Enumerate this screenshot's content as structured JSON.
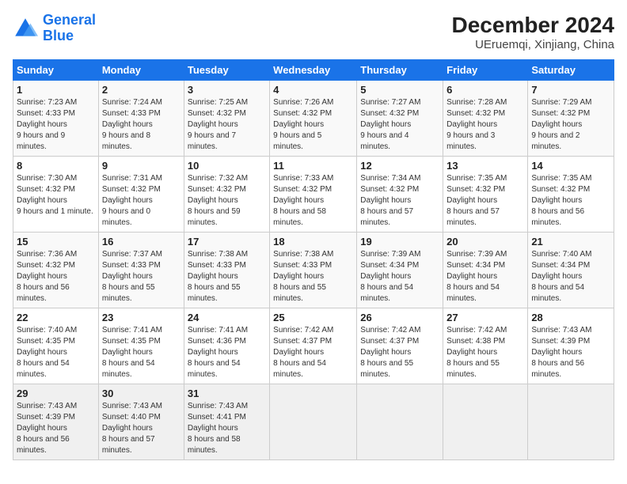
{
  "header": {
    "logo_line1": "General",
    "logo_line2": "Blue",
    "title": "December 2024",
    "subtitle": "UEruemqi, Xinjiang, China"
  },
  "weekdays": [
    "Sunday",
    "Monday",
    "Tuesday",
    "Wednesday",
    "Thursday",
    "Friday",
    "Saturday"
  ],
  "weeks": [
    [
      {
        "day": "1",
        "sunrise": "7:23 AM",
        "sunset": "4:33 PM",
        "daylight": "9 hours and 9 minutes."
      },
      {
        "day": "2",
        "sunrise": "7:24 AM",
        "sunset": "4:33 PM",
        "daylight": "9 hours and 8 minutes."
      },
      {
        "day": "3",
        "sunrise": "7:25 AM",
        "sunset": "4:32 PM",
        "daylight": "9 hours and 7 minutes."
      },
      {
        "day": "4",
        "sunrise": "7:26 AM",
        "sunset": "4:32 PM",
        "daylight": "9 hours and 5 minutes."
      },
      {
        "day": "5",
        "sunrise": "7:27 AM",
        "sunset": "4:32 PM",
        "daylight": "9 hours and 4 minutes."
      },
      {
        "day": "6",
        "sunrise": "7:28 AM",
        "sunset": "4:32 PM",
        "daylight": "9 hours and 3 minutes."
      },
      {
        "day": "7",
        "sunrise": "7:29 AM",
        "sunset": "4:32 PM",
        "daylight": "9 hours and 2 minutes."
      }
    ],
    [
      {
        "day": "8",
        "sunrise": "7:30 AM",
        "sunset": "4:32 PM",
        "daylight": "9 hours and 1 minute."
      },
      {
        "day": "9",
        "sunrise": "7:31 AM",
        "sunset": "4:32 PM",
        "daylight": "9 hours and 0 minutes."
      },
      {
        "day": "10",
        "sunrise": "7:32 AM",
        "sunset": "4:32 PM",
        "daylight": "8 hours and 59 minutes."
      },
      {
        "day": "11",
        "sunrise": "7:33 AM",
        "sunset": "4:32 PM",
        "daylight": "8 hours and 58 minutes."
      },
      {
        "day": "12",
        "sunrise": "7:34 AM",
        "sunset": "4:32 PM",
        "daylight": "8 hours and 57 minutes."
      },
      {
        "day": "13",
        "sunrise": "7:35 AM",
        "sunset": "4:32 PM",
        "daylight": "8 hours and 57 minutes."
      },
      {
        "day": "14",
        "sunrise": "7:35 AM",
        "sunset": "4:32 PM",
        "daylight": "8 hours and 56 minutes."
      }
    ],
    [
      {
        "day": "15",
        "sunrise": "7:36 AM",
        "sunset": "4:32 PM",
        "daylight": "8 hours and 56 minutes."
      },
      {
        "day": "16",
        "sunrise": "7:37 AM",
        "sunset": "4:33 PM",
        "daylight": "8 hours and 55 minutes."
      },
      {
        "day": "17",
        "sunrise": "7:38 AM",
        "sunset": "4:33 PM",
        "daylight": "8 hours and 55 minutes."
      },
      {
        "day": "18",
        "sunrise": "7:38 AM",
        "sunset": "4:33 PM",
        "daylight": "8 hours and 55 minutes."
      },
      {
        "day": "19",
        "sunrise": "7:39 AM",
        "sunset": "4:34 PM",
        "daylight": "8 hours and 54 minutes."
      },
      {
        "day": "20",
        "sunrise": "7:39 AM",
        "sunset": "4:34 PM",
        "daylight": "8 hours and 54 minutes."
      },
      {
        "day": "21",
        "sunrise": "7:40 AM",
        "sunset": "4:34 PM",
        "daylight": "8 hours and 54 minutes."
      }
    ],
    [
      {
        "day": "22",
        "sunrise": "7:40 AM",
        "sunset": "4:35 PM",
        "daylight": "8 hours and 54 minutes."
      },
      {
        "day": "23",
        "sunrise": "7:41 AM",
        "sunset": "4:35 PM",
        "daylight": "8 hours and 54 minutes."
      },
      {
        "day": "24",
        "sunrise": "7:41 AM",
        "sunset": "4:36 PM",
        "daylight": "8 hours and 54 minutes."
      },
      {
        "day": "25",
        "sunrise": "7:42 AM",
        "sunset": "4:37 PM",
        "daylight": "8 hours and 54 minutes."
      },
      {
        "day": "26",
        "sunrise": "7:42 AM",
        "sunset": "4:37 PM",
        "daylight": "8 hours and 55 minutes."
      },
      {
        "day": "27",
        "sunrise": "7:42 AM",
        "sunset": "4:38 PM",
        "daylight": "8 hours and 55 minutes."
      },
      {
        "day": "28",
        "sunrise": "7:43 AM",
        "sunset": "4:39 PM",
        "daylight": "8 hours and 56 minutes."
      }
    ],
    [
      {
        "day": "29",
        "sunrise": "7:43 AM",
        "sunset": "4:39 PM",
        "daylight": "8 hours and 56 minutes."
      },
      {
        "day": "30",
        "sunrise": "7:43 AM",
        "sunset": "4:40 PM",
        "daylight": "8 hours and 57 minutes."
      },
      {
        "day": "31",
        "sunrise": "7:43 AM",
        "sunset": "4:41 PM",
        "daylight": "8 hours and 58 minutes."
      },
      null,
      null,
      null,
      null
    ]
  ]
}
